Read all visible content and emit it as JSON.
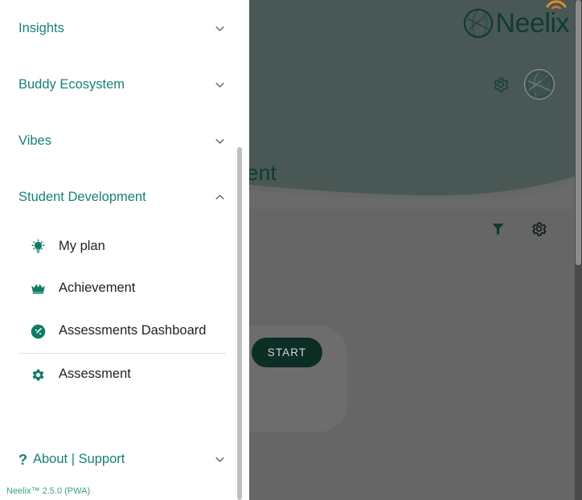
{
  "brand": {
    "name": "Neelix",
    "logo_icon": "globe-network-icon",
    "arc_icon": "wifi-arc-icon",
    "arc_color": "#e08a2e",
    "wordmark_color": "#0f3b30"
  },
  "header": {
    "background_color": "#495855",
    "overlay_color": "#666666",
    "page_title": "Assessment",
    "page_title_visible_text": "sessment",
    "page_title_color": "#0d3b2f",
    "settings_icon": "gear-icon",
    "avatar_icon": "user-avatar-globe-icon"
  },
  "toolbar": {
    "filter_icon": "filter-funnel-icon",
    "settings_icon": "gear-icon"
  },
  "main": {
    "start_label": "START",
    "start_bg": "#0c2e25",
    "start_text_color": "#cfd4d2"
  },
  "sidebar": {
    "accent_color": "#1a8071",
    "groups": [
      {
        "label": "Insights",
        "expanded": false,
        "chevron": "chevron-down-icon"
      },
      {
        "label": "Buddy Ecosystem",
        "expanded": false,
        "chevron": "chevron-down-icon"
      },
      {
        "label": "Vibes",
        "expanded": false,
        "chevron": "chevron-down-icon"
      },
      {
        "label": "Student Development",
        "expanded": true,
        "chevron": "chevron-up-icon"
      }
    ],
    "student_development_items": [
      {
        "label": "My plan",
        "icon": "lightbulb-icon"
      },
      {
        "label": "Achievement",
        "icon": "crown-icon"
      },
      {
        "label": "Assessments Dashboard",
        "icon": "gauge-dashboard-icon"
      },
      {
        "label": "Assessment",
        "icon": "cog-icon"
      }
    ],
    "about": {
      "label": "About | Support",
      "icon": "question-mark-icon",
      "chevron": "chevron-down-icon"
    },
    "version": "Neelix™ 2.5.0 (PWA)"
  }
}
